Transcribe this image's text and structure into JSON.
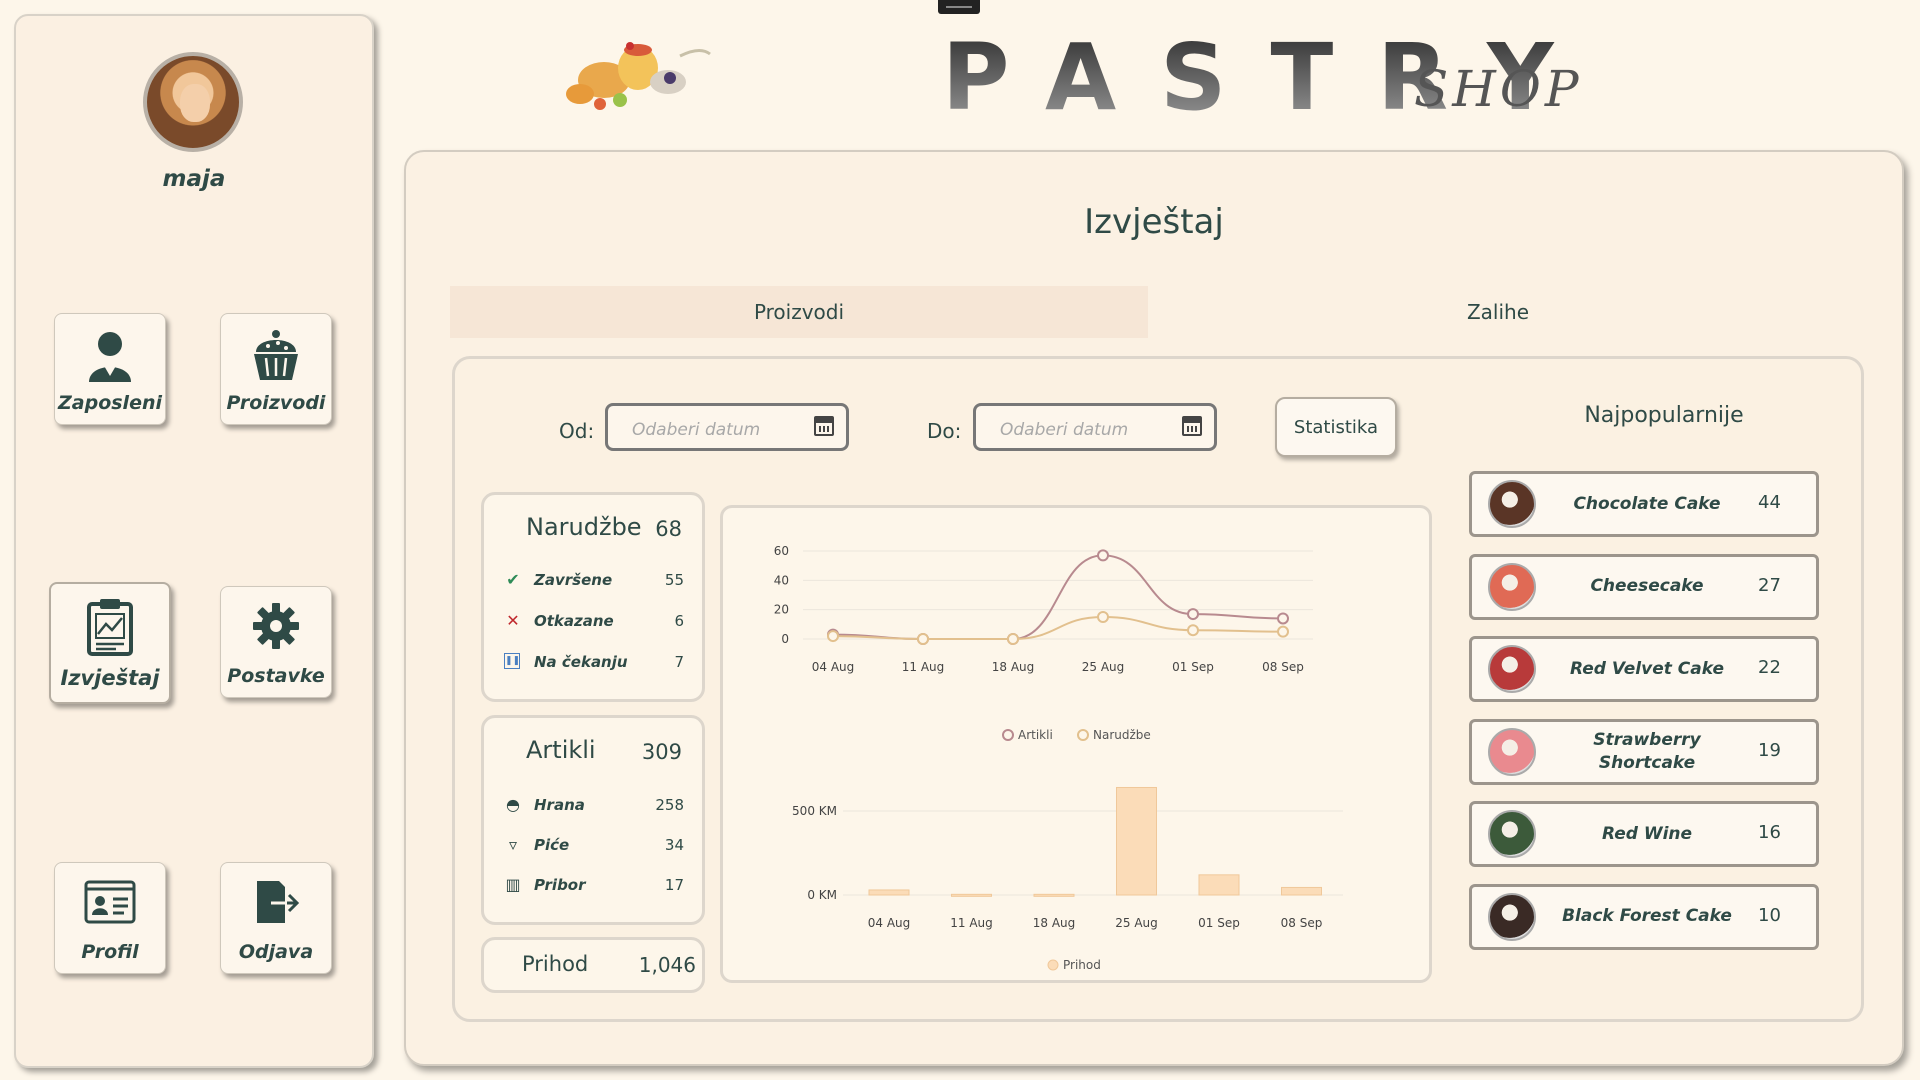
{
  "user": {
    "name": "maja"
  },
  "nav": [
    {
      "key": "zaposleni",
      "label": "Zaposleni",
      "icon": "employee-icon"
    },
    {
      "key": "proizvodi",
      "label": "Proizvodi",
      "icon": "cake-icon"
    },
    {
      "key": "izvjestaj",
      "label": "Izvještaj",
      "icon": "report-icon"
    },
    {
      "key": "postavke",
      "label": "Postavke",
      "icon": "gear-icon"
    },
    {
      "key": "profil",
      "label": "Profil",
      "icon": "profile-card-icon"
    },
    {
      "key": "odjava",
      "label": "Odjava",
      "icon": "logout-icon"
    }
  ],
  "brand": {
    "main": "PASTRY",
    "sub": "SHOP"
  },
  "page": {
    "title": "Izvještaj"
  },
  "tabs": [
    {
      "label": "Proizvodi",
      "active": true
    },
    {
      "label": "Zalihe",
      "active": false
    }
  ],
  "filters": {
    "from_label": "Od:",
    "to_label": "Do:",
    "from_placeholder": "Odaberi datum",
    "to_placeholder": "Odaberi datum",
    "stat_button": "Statistika"
  },
  "orders": {
    "title": "Narudžbe",
    "total": "68",
    "rows": [
      {
        "label": "Završene",
        "value": "55",
        "icon": "check-icon",
        "color": "#2e8b57"
      },
      {
        "label": "Otkazane",
        "value": "6",
        "icon": "x-icon",
        "color": "#c0282d"
      },
      {
        "label": "Na čekanju",
        "value": "7",
        "icon": "pause-icon",
        "color": "#4a7fc1"
      }
    ]
  },
  "articles": {
    "title": "Artikli",
    "total": "309",
    "rows": [
      {
        "label": "Hrana",
        "value": "258",
        "icon": "burger-icon"
      },
      {
        "label": "Piće",
        "value": "34",
        "icon": "cup-icon"
      },
      {
        "label": "Pribor",
        "value": "17",
        "icon": "gift-icon"
      }
    ]
  },
  "revenue": {
    "title": "Prihod",
    "value": "1,046"
  },
  "popular": {
    "title": "Najpopularnije",
    "items": [
      {
        "name": "Chocolate Cake",
        "count": "44",
        "thumb_color": "#5a3526"
      },
      {
        "name": "Cheesecake",
        "count": "27",
        "thumb_color": "#e06a55"
      },
      {
        "name": "Red Velvet Cake",
        "count": "22",
        "thumb_color": "#b83a3a"
      },
      {
        "name": "Strawberry Shortcake",
        "count": "19",
        "thumb_color": "#e98a8f"
      },
      {
        "name": "Red Wine",
        "count": "16",
        "thumb_color": "#3c5a3a"
      },
      {
        "name": "Black Forest Cake",
        "count": "10",
        "thumb_color": "#3a2a25"
      }
    ]
  },
  "chart_data": [
    {
      "type": "line",
      "x": [
        "04 Aug",
        "11 Aug",
        "18 Aug",
        "25 Aug",
        "01 Sep",
        "08 Sep"
      ],
      "yticks": [
        "60",
        "40",
        "20",
        "0"
      ],
      "ylim": [
        0,
        60
      ],
      "series": [
        {
          "name": "Artikli",
          "values": [
            3,
            0,
            0,
            57,
            17,
            14
          ],
          "color": "#b88a8f"
        },
        {
          "name": "Narudžbe",
          "values": [
            2,
            0,
            0,
            15,
            6,
            5
          ],
          "color": "#e2c08e"
        }
      ],
      "legend": "bottom"
    },
    {
      "type": "bar",
      "categories": [
        "04 Aug",
        "11 Aug",
        "18 Aug",
        "25 Aug",
        "01 Sep",
        "08 Sep"
      ],
      "yticks": [
        "500 KM",
        "0 KM"
      ],
      "ylim": [
        0,
        500
      ],
      "series": [
        {
          "name": "Prihod",
          "values": [
            30,
            4,
            4,
            640,
            120,
            45
          ],
          "color": "#fbdcb8"
        }
      ],
      "legend": "bottom"
    }
  ]
}
